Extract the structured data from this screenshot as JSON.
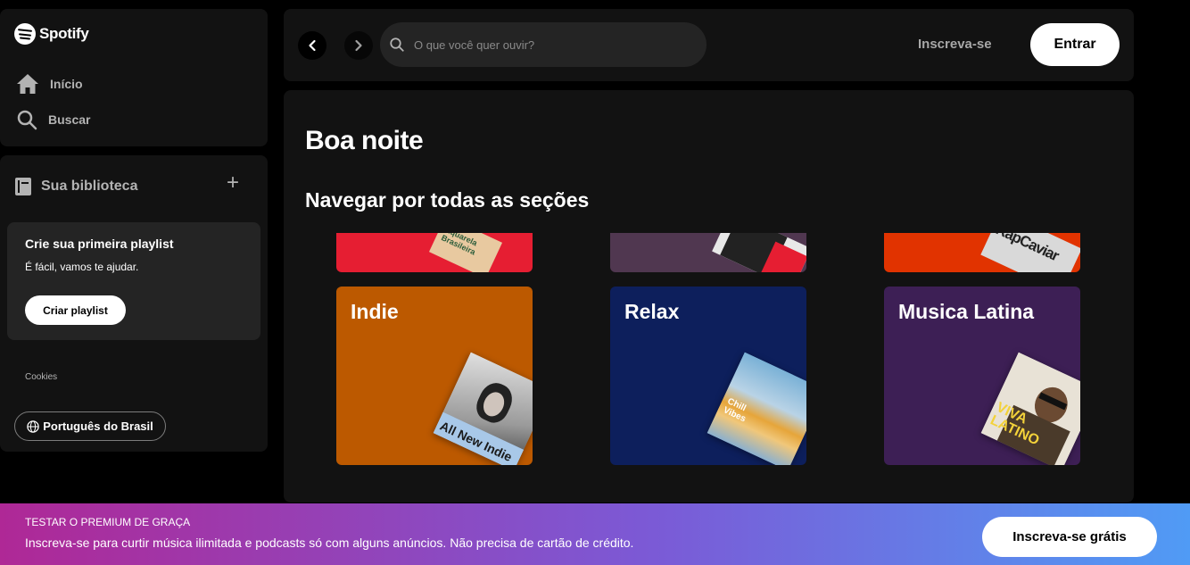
{
  "brand": {
    "name": "Spotify"
  },
  "nav": {
    "home": {
      "label": "Início",
      "icon": "home-icon"
    },
    "search": {
      "label": "Buscar",
      "icon": "search-icon"
    }
  },
  "library": {
    "title": "Sua biblioteca",
    "icon": "library-icon",
    "add_icon": "plus-icon",
    "playlist_prompt": {
      "title": "Crie sua primeira playlist",
      "subtitle": "É fácil, vamos te ajudar.",
      "button": "Criar playlist"
    },
    "cookies": "Cookies",
    "language": "Português do Brasil"
  },
  "topbar": {
    "search_placeholder": "O que você quer ouvir?",
    "signup": "Inscreva-se",
    "login": "Entrar"
  },
  "main": {
    "greeting": "Boa noite",
    "section_title": "Navegar por todas as seções",
    "top_row": [
      {
        "color": "#e61e32",
        "cover_text": "Aquarela Brasileira"
      },
      {
        "color": "#503750",
        "cover_text": ""
      },
      {
        "color": "#e13300",
        "cover_text": "RapCaviar"
      }
    ],
    "genres": [
      {
        "title": "Indie",
        "color": "#bc5900",
        "cover_text": "All New Indie",
        "cover_color": "#a8c8e8"
      },
      {
        "title": "Relax",
        "color": "#0d1f5c",
        "cover_text": "Chill Vibes",
        "cover_color": "#e6a53a"
      },
      {
        "title": "Musica Latina",
        "color": "#3d1f55",
        "cover_text": "VIVA LATINO",
        "cover_color": "#f3d23a"
      }
    ]
  },
  "banner": {
    "kicker": "TESTAR O PREMIUM DE GRAÇA",
    "text": "Inscreva-se para curtir música ilimitada e podcasts só com alguns anúncios. Não precisa de cartão de crédito.",
    "button": "Inscreva-se grátis"
  }
}
